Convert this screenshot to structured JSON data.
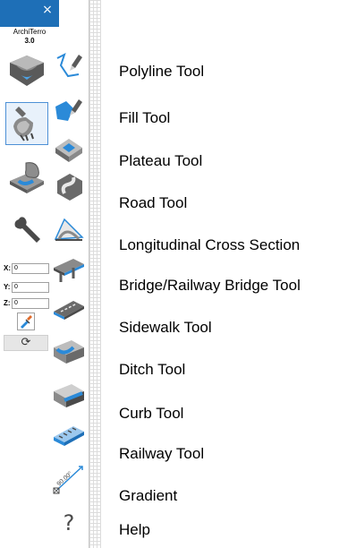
{
  "window": {
    "app_name": "ArchiTerro",
    "version": "3.0",
    "close_glyph": "×",
    "titlebar_color": "#1e6fb7"
  },
  "main_buttons": [
    {
      "icon": "terrain-icon",
      "selected": false
    },
    {
      "icon": "excavator-icon",
      "selected": true
    },
    {
      "icon": "terrain-modify-icon",
      "selected": false
    },
    {
      "icon": "wrench-icon",
      "selected": false
    }
  ],
  "coordinates": {
    "x_label": "X:",
    "x_value": "0",
    "y_label": "Y:",
    "y_value": "0",
    "z_label": "Z:",
    "z_value": "0"
  },
  "refresh_glyph": "⟳",
  "tools": [
    {
      "icon": "polyline-icon",
      "label": "Polyline Tool"
    },
    {
      "icon": "fill-icon",
      "label": "Fill Tool"
    },
    {
      "icon": "plateau-icon",
      "label": "Plateau Tool"
    },
    {
      "icon": "road-icon",
      "label": "Road Tool"
    },
    {
      "icon": "cross-section-icon",
      "label": "Longitudinal Cross Section"
    },
    {
      "icon": "bridge-icon",
      "label": "Bridge/Railway Bridge Tool"
    },
    {
      "icon": "sidewalk-icon",
      "label": "Sidewalk Tool"
    },
    {
      "icon": "ditch-icon",
      "label": "Ditch Tool"
    },
    {
      "icon": "curb-icon",
      "label": "Curb Tool"
    },
    {
      "icon": "railway-icon",
      "label": "Railway Tool"
    },
    {
      "icon": "gradient-icon",
      "label": "Gradient",
      "icon_text": "90.00°"
    },
    {
      "icon": "help-icon",
      "label": "Help",
      "icon_text": "?"
    }
  ],
  "colors": {
    "accent_blue": "#2b8ad8",
    "light_blue": "#9cc8ee",
    "dark_gray": "#4a4a4a",
    "mid_gray": "#8c8c8c"
  }
}
